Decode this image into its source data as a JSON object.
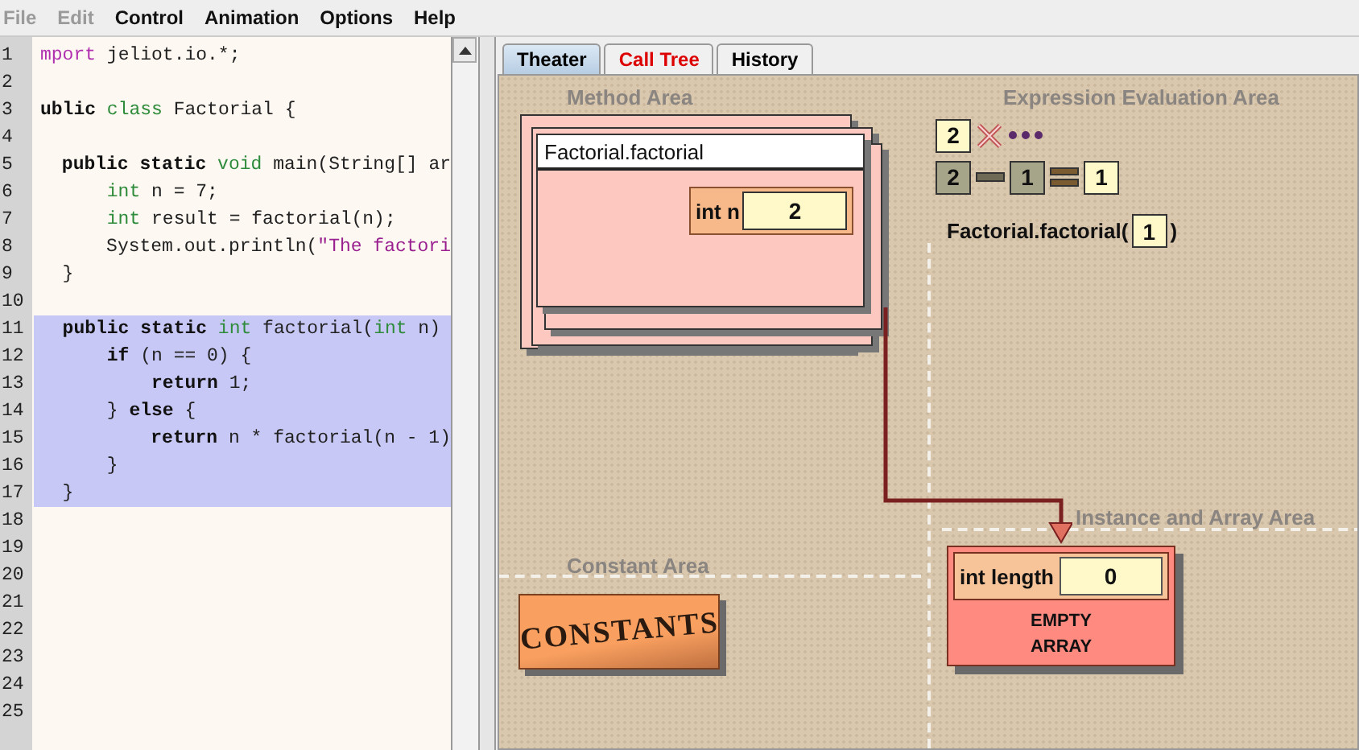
{
  "menu": [
    {
      "label": "File",
      "disabled": true
    },
    {
      "label": "Edit",
      "disabled": true
    },
    {
      "label": "Control",
      "disabled": false
    },
    {
      "label": "Animation",
      "disabled": false
    },
    {
      "label": "Options",
      "disabled": false
    },
    {
      "label": "Help",
      "disabled": false
    }
  ],
  "editor": {
    "lines": [
      {
        "number": "1",
        "highlighted": false,
        "tokens": [
          {
            "text": "mport",
            "kind": "directive"
          },
          {
            "text": " jeliot.io.*;",
            "kind": "plain"
          }
        ]
      },
      {
        "number": "2",
        "highlighted": false
      },
      {
        "number": "3",
        "highlighted": false,
        "tokens": [
          {
            "text": "ublic",
            "kind": "keyword"
          },
          {
            "text": " class",
            "kind": "type"
          },
          {
            "text": " Factorial {",
            "kind": "plain"
          }
        ]
      },
      {
        "number": "4",
        "highlighted": false
      },
      {
        "number": "5",
        "highlighted": false,
        "tokens": [
          {
            "text": "  public static",
            "kind": "keyword"
          },
          {
            "text": " void",
            "kind": "type"
          },
          {
            "text": " main(String[] ar",
            "kind": "plain"
          }
        ]
      },
      {
        "number": "6",
        "highlighted": false,
        "tokens": [
          {
            "text": "      int",
            "kind": "type"
          },
          {
            "text": " n = 7;",
            "kind": "plain"
          }
        ]
      },
      {
        "number": "7",
        "highlighted": false,
        "tokens": [
          {
            "text": "      int",
            "kind": "type"
          },
          {
            "text": " result = factorial(n);",
            "kind": "plain"
          }
        ]
      },
      {
        "number": "8",
        "highlighted": false,
        "tokens": [
          {
            "text": "      System.out.println(",
            "kind": "plain"
          },
          {
            "text": "\"The factori",
            "kind": "string"
          }
        ]
      },
      {
        "number": "9",
        "highlighted": false,
        "tokens": [
          {
            "text": "  }",
            "kind": "plain"
          }
        ]
      },
      {
        "number": "10",
        "highlighted": false
      },
      {
        "number": "11",
        "highlighted": true,
        "tokens": [
          {
            "text": "  public static",
            "kind": "keyword"
          },
          {
            "text": " int",
            "kind": "type"
          },
          {
            "text": " factorial(",
            "kind": "plain"
          },
          {
            "text": "int",
            "kind": "type"
          },
          {
            "text": " n)",
            "kind": "plain"
          }
        ]
      },
      {
        "number": "12",
        "highlighted": true,
        "tokens": [
          {
            "text": "      if",
            "kind": "keyword"
          },
          {
            "text": " (n == 0) {",
            "kind": "plain"
          }
        ]
      },
      {
        "number": "13",
        "highlighted": true,
        "tokens": [
          {
            "text": "          return",
            "kind": "keyword"
          },
          {
            "text": " 1;",
            "kind": "plain"
          }
        ]
      },
      {
        "number": "14",
        "highlighted": true,
        "tokens": [
          {
            "text": "      } ",
            "kind": "plain"
          },
          {
            "text": "else",
            "kind": "keyword"
          },
          {
            "text": " {",
            "kind": "plain"
          }
        ]
      },
      {
        "number": "15",
        "highlighted": true,
        "tokens": [
          {
            "text": "          return",
            "kind": "keyword"
          },
          {
            "text": " n * factorial(n - 1)",
            "kind": "plain"
          }
        ]
      },
      {
        "number": "16",
        "highlighted": true,
        "tokens": [
          {
            "text": "      }",
            "kind": "plain"
          }
        ]
      },
      {
        "number": "17",
        "highlighted": true,
        "tokens": [
          {
            "text": "  }",
            "kind": "plain"
          }
        ]
      },
      {
        "number": "18",
        "highlighted": false
      },
      {
        "number": "19",
        "highlighted": false
      },
      {
        "number": "20",
        "highlighted": false
      },
      {
        "number": "21",
        "highlighted": false
      },
      {
        "number": "22",
        "highlighted": false
      },
      {
        "number": "23",
        "highlighted": false
      },
      {
        "number": "24",
        "highlighted": false
      },
      {
        "number": "25",
        "highlighted": false
      }
    ]
  },
  "tabs": [
    {
      "label": "Theater",
      "selected": true,
      "color": "#000000"
    },
    {
      "label": "Call Tree",
      "selected": false,
      "color": "#dd0000"
    },
    {
      "label": "History",
      "selected": false,
      "color": "#000000"
    }
  ],
  "theater": {
    "method_area": {
      "title": "Method Area",
      "frame": {
        "title": "Factorial.factorial",
        "variable": "int n",
        "value": "2"
      }
    },
    "expression_area": {
      "title": "Expression Evaluation Area",
      "rows": [
        [
          {
            "kind": "value",
            "text": "2"
          },
          {
            "kind": "times"
          },
          {
            "kind": "pending"
          }
        ],
        [
          {
            "kind": "operand",
            "text": "2"
          },
          {
            "kind": "minus"
          },
          {
            "kind": "operand",
            "text": "1"
          },
          {
            "kind": "equals"
          },
          {
            "kind": "value",
            "text": "1"
          }
        ]
      ],
      "call": {
        "method": "Factorial.factorial(",
        "argument": "1",
        "close": ")"
      }
    },
    "constant_area": {
      "title": "Constant Area",
      "sign": "CONSTANTS"
    },
    "instance_area": {
      "title": "Instance and Array Area",
      "array": {
        "field": "int length",
        "value": "0",
        "body": "EMPTY ARRAY"
      }
    }
  }
}
